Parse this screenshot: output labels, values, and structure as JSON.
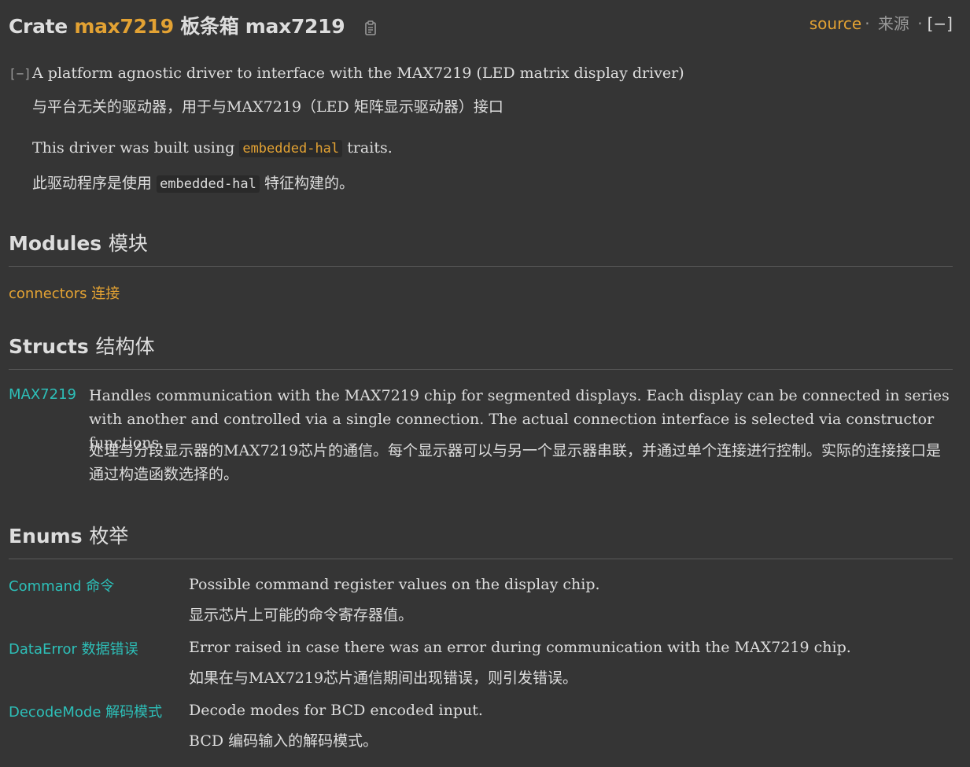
{
  "header": {
    "crate_label": "Crate",
    "crate_name": "max7219",
    "crate_zh": "板条箱 max7219",
    "copy_icon": "clipboard-icon",
    "source_label": "source",
    "separator": "·",
    "source_zh": "来源",
    "toggle_label": "[−]"
  },
  "docblock": {
    "collapse_toggle": "[−]",
    "line1": "A platform agnostic driver to interface with the MAX7219 (LED matrix display driver)",
    "line1_zh": "与平台无关的驱动器，用于与MAX7219（LED 矩阵显示驱动器）接口",
    "line2_prefix": "This driver was built using",
    "line2_code": "embedded-hal",
    "line2_suffix": "traits.",
    "line2_zh_prefix": "此驱动程序是使用",
    "line2_zh_code": "embedded-hal",
    "line2_zh_suffix": "特征构建的。"
  },
  "modules": {
    "heading": "Modules",
    "heading_zh": "模块",
    "items": [
      {
        "name": "connectors 连接"
      }
    ]
  },
  "structs": {
    "heading": "Structs",
    "heading_zh": "结构体",
    "items": [
      {
        "name": "MAX7219",
        "desc": "Handles communication with the MAX7219 chip for segmented displays. Each display can be connected in series with another and controlled via a single connection. The actual connection interface is selected via constructor functions.",
        "desc_zh": "处理与分段显示器的MAX7219芯片的通信。每个显示器可以与另一个显示器串联，并通过单个连接进行控制。实际的连接接口是通过构造函数选择的。"
      }
    ]
  },
  "enums": {
    "heading": "Enums",
    "heading_zh": "枚举",
    "items": [
      {
        "name": "Command 命令",
        "desc": "Possible command register values on the display chip.",
        "desc_zh": "显示芯片上可能的命令寄存器值。"
      },
      {
        "name": "DataError 数据错误",
        "desc": "Error raised in case there was an error during communication with the MAX7219 chip.",
        "desc_zh": "如果在与MAX7219芯片通信期间出现错误，则引发错误。"
      },
      {
        "name": "DecodeMode 解码模式",
        "desc": "Decode modes for BCD encoded input.",
        "desc_zh": "BCD 编码输入的解码模式。"
      }
    ]
  },
  "colors": {
    "background": "#353535",
    "text": "#dddddd",
    "crate_link": "#e3a233",
    "struct_enum_link": "#2dbfb8",
    "muted": "#999999"
  }
}
